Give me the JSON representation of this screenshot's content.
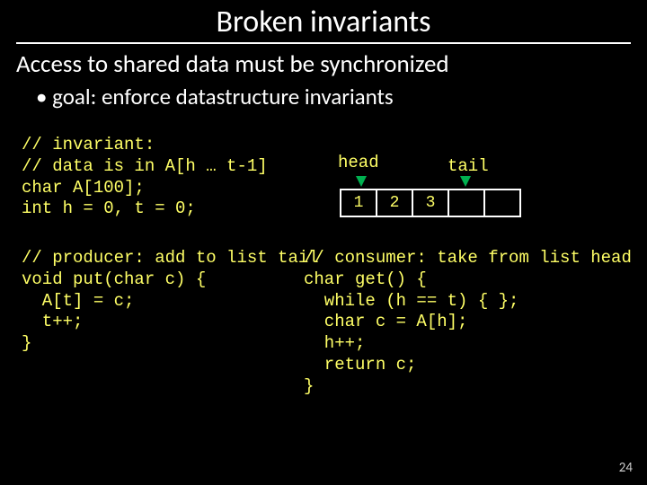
{
  "title": "Broken invariants",
  "subtitle": "Access to shared data must be synchronized",
  "bullet": "goal: enforce datastructure invariants",
  "code_top": {
    "l1": "// invariant:",
    "l2": "// data is in A[h … t-1]",
    "l3": "char A[100];",
    "l4": "int h = 0, t = 0;"
  },
  "diagram": {
    "head": "head",
    "tail": "tail",
    "cells": {
      "c1": "1",
      "c2": "2",
      "c3": "3",
      "c4": "",
      "c5": ""
    }
  },
  "producer": {
    "l1": "// producer: add to list tail",
    "l2": "void put(char c) {",
    "l3": "  A[t] = c;",
    "l4": "  t++;",
    "l5": "}"
  },
  "consumer": {
    "l1": "// consumer: take from list head",
    "l2": "char get() {",
    "l3": "  while (h == t) { };",
    "l4": "  char c = A[h];",
    "l5": "  h++;",
    "l6": "  return c;",
    "l7": "}"
  },
  "pagenum": "24"
}
